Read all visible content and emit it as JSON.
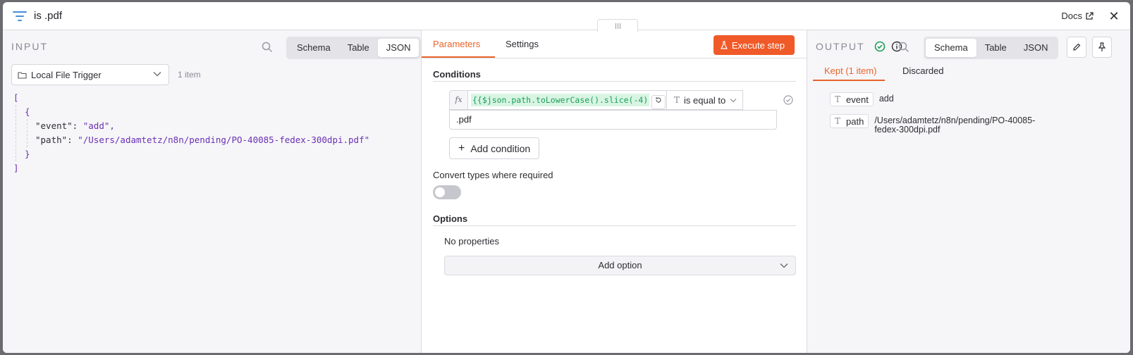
{
  "header": {
    "title": "is .pdf",
    "docs_label": "Docs",
    "close_symbol": "✕"
  },
  "input": {
    "label": "INPUT",
    "views": [
      "Schema",
      "Table",
      "JSON"
    ],
    "active_view": "JSON",
    "node_name": "Local File Trigger",
    "item_count": "1 item",
    "json": {
      "event_key": "\"event\":",
      "event_value": "\"add\",",
      "path_key": "\"path\":",
      "path_value": "\"/Users/adamtetz/n8n/pending/PO-40085-fedex-300dpi.pdf\""
    }
  },
  "params": {
    "tabs": [
      "Parameters",
      "Settings"
    ],
    "active_tab": "Parameters",
    "execute_label": "Execute step",
    "conditions_title": "Conditions",
    "condition": {
      "fx": "fx",
      "expression": "{{$json.path.toLowerCase().slice(-4)",
      "operator": "is equal to",
      "value": ".pdf"
    },
    "add_condition_label": "Add condition",
    "convert_label": "Convert types where required",
    "convert_enabled": false,
    "options_title": "Options",
    "no_properties": "No properties",
    "add_option_label": "Add option"
  },
  "output": {
    "label": "OUTPUT",
    "views": [
      "Schema",
      "Table",
      "JSON"
    ],
    "active_view": "Schema",
    "tabs": [
      "Kept (1 item)",
      "Discarded"
    ],
    "active_tab": "Kept (1 item)",
    "fields": [
      {
        "name": "event",
        "value": "add"
      },
      {
        "name": "path",
        "value_line1": "/Users/adamtetz/n8n/pending/PO-40085-",
        "value_line2": "fedex-300dpi.pdf"
      }
    ]
  },
  "colors": {
    "accent": "#f05a28",
    "success": "#1c9e5a",
    "json_string": "#6a2fb5"
  }
}
